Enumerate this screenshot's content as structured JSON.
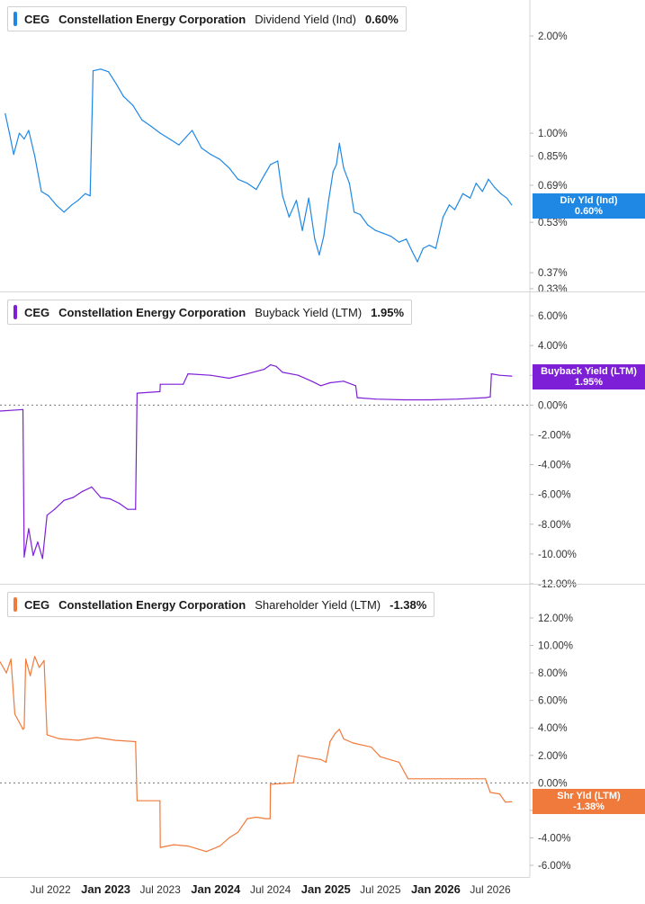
{
  "panels": [
    {
      "ticker": "CEG",
      "company": "Constellation Energy Corporation",
      "metric": "Dividend Yield (Ind)",
      "value": "0.60%",
      "badge_label": "Div Yld (Ind)",
      "badge_value": "0.60%",
      "color": "#1f88e5"
    },
    {
      "ticker": "CEG",
      "company": "Constellation Energy Corporation",
      "metric": "Buyback Yield (LTM)",
      "value": "1.95%",
      "badge_label": "Buyback Yield (LTM)",
      "badge_value": "1.95%",
      "color": "#7e1fd8"
    },
    {
      "ticker": "CEG",
      "company": "Constellation Energy Corporation",
      "metric": "Shareholder Yield (LTM)",
      "value": "-1.38%",
      "badge_label": "Shr Yld (LTM)",
      "badge_value": "-1.38%",
      "color": "#f07a3c"
    }
  ],
  "chart_data": [
    {
      "type": "line",
      "scale": "log",
      "y_ticks": [
        "2.00%",
        "1.00%",
        "0.85%",
        "0.69%",
        "0.53%",
        "0.37%",
        "0.33%"
      ],
      "y_tick_values": [
        2.0,
        1.0,
        0.85,
        0.69,
        0.53,
        0.37,
        0.33
      ],
      "ylim": [
        0.33,
        2.5
      ],
      "series": [
        {
          "name": "Dividend Yield (Ind)",
          "color": "#1f88e5",
          "points": [
            [
              "2022-02-01",
              1.15
            ],
            [
              "2022-02-15",
              1.0
            ],
            [
              "2022-03-01",
              0.86
            ],
            [
              "2022-03-20",
              1.0
            ],
            [
              "2022-04-05",
              0.96
            ],
            [
              "2022-04-20",
              1.02
            ],
            [
              "2022-05-10",
              0.85
            ],
            [
              "2022-06-01",
              0.66
            ],
            [
              "2022-06-25",
              0.64
            ],
            [
              "2022-07-20",
              0.6
            ],
            [
              "2022-08-15",
              0.57
            ],
            [
              "2022-09-10",
              0.6
            ],
            [
              "2022-10-01",
              0.62
            ],
            [
              "2022-10-25",
              0.65
            ],
            [
              "2022-11-10",
              0.64
            ],
            [
              "2022-11-20",
              1.56
            ],
            [
              "2022-12-15",
              1.58
            ],
            [
              "2023-01-10",
              1.55
            ],
            [
              "2023-02-05",
              1.42
            ],
            [
              "2023-03-01",
              1.3
            ],
            [
              "2023-04-01",
              1.22
            ],
            [
              "2023-05-01",
              1.1
            ],
            [
              "2023-06-01",
              1.05
            ],
            [
              "2023-07-01",
              1.0
            ],
            [
              "2023-08-01",
              0.96
            ],
            [
              "2023-09-01",
              0.92
            ],
            [
              "2023-10-15",
              1.02
            ],
            [
              "2023-11-15",
              0.9
            ],
            [
              "2023-12-15",
              0.86
            ],
            [
              "2024-01-15",
              0.83
            ],
            [
              "2024-02-15",
              0.78
            ],
            [
              "2024-03-15",
              0.72
            ],
            [
              "2024-04-15",
              0.7
            ],
            [
              "2024-05-15",
              0.67
            ],
            [
              "2024-06-10",
              0.74
            ],
            [
              "2024-07-01",
              0.8
            ],
            [
              "2024-07-25",
              0.82
            ],
            [
              "2024-08-10",
              0.64
            ],
            [
              "2024-09-01",
              0.55
            ],
            [
              "2024-09-25",
              0.62
            ],
            [
              "2024-10-15",
              0.5
            ],
            [
              "2024-11-05",
              0.63
            ],
            [
              "2024-11-25",
              0.47
            ],
            [
              "2024-12-10",
              0.42
            ],
            [
              "2024-12-25",
              0.48
            ],
            [
              "2025-01-10",
              0.62
            ],
            [
              "2025-01-25",
              0.76
            ],
            [
              "2025-02-05",
              0.8
            ],
            [
              "2025-02-15",
              0.93
            ],
            [
              "2025-03-01",
              0.78
            ],
            [
              "2025-03-20",
              0.7
            ],
            [
              "2025-04-05",
              0.57
            ],
            [
              "2025-04-25",
              0.56
            ],
            [
              "2025-05-20",
              0.52
            ],
            [
              "2025-06-15",
              0.5
            ],
            [
              "2025-07-10",
              0.49
            ],
            [
              "2025-08-05",
              0.48
            ],
            [
              "2025-09-01",
              0.46
            ],
            [
              "2025-09-25",
              0.47
            ],
            [
              "2025-10-15",
              0.43
            ],
            [
              "2025-11-01",
              0.4
            ],
            [
              "2025-11-20",
              0.44
            ],
            [
              "2025-12-10",
              0.45
            ],
            [
              "2026-01-01",
              0.44
            ],
            [
              "2026-01-25",
              0.55
            ],
            [
              "2026-02-15",
              0.6
            ],
            [
              "2026-03-05",
              0.58
            ],
            [
              "2026-04-01",
              0.65
            ],
            [
              "2026-04-25",
              0.63
            ],
            [
              "2026-05-15",
              0.7
            ],
            [
              "2026-06-05",
              0.66
            ],
            [
              "2026-06-25",
              0.72
            ],
            [
              "2026-07-15",
              0.68
            ],
            [
              "2026-08-05",
              0.65
            ],
            [
              "2026-08-25",
              0.63
            ],
            [
              "2026-09-10",
              0.6
            ]
          ]
        }
      ]
    },
    {
      "type": "line",
      "y_ticks": [
        "6.00%",
        "4.00%",
        "2.00%",
        "0.00%",
        "-2.00%",
        "-4.00%",
        "-6.00%",
        "-8.00%",
        "-10.00%",
        "-12.00%"
      ],
      "y_tick_values": [
        6,
        4,
        2,
        0,
        -2,
        -4,
        -6,
        -8,
        -10,
        -12
      ],
      "ylim": [
        -12,
        7
      ],
      "series": [
        {
          "name": "Buyback Yield (LTM)",
          "color": "#7e1fd8",
          "points": [
            [
              "2022-01-15",
              -0.4
            ],
            [
              "2022-04-01",
              -0.3
            ],
            [
              "2022-04-05",
              -10.2
            ],
            [
              "2022-04-20",
              -8.3
            ],
            [
              "2022-05-05",
              -10.1
            ],
            [
              "2022-05-20",
              -9.2
            ],
            [
              "2022-06-05",
              -10.3
            ],
            [
              "2022-06-20",
              -7.4
            ],
            [
              "2022-07-15",
              -7.0
            ],
            [
              "2022-08-15",
              -6.4
            ],
            [
              "2022-09-15",
              -6.2
            ],
            [
              "2022-10-15",
              -5.8
            ],
            [
              "2022-11-15",
              -5.5
            ],
            [
              "2022-12-15",
              -6.2
            ],
            [
              "2023-01-15",
              -6.3
            ],
            [
              "2023-02-15",
              -6.6
            ],
            [
              "2023-03-15",
              -7.0
            ],
            [
              "2023-04-10",
              -7.0
            ],
            [
              "2023-04-15",
              0.8
            ],
            [
              "2023-06-30",
              0.9
            ],
            [
              "2023-07-01",
              1.4
            ],
            [
              "2023-09-15",
              1.4
            ],
            [
              "2023-10-01",
              2.1
            ],
            [
              "2023-12-15",
              2.0
            ],
            [
              "2024-02-15",
              1.8
            ],
            [
              "2024-04-15",
              2.1
            ],
            [
              "2024-06-10",
              2.4
            ],
            [
              "2024-07-01",
              2.7
            ],
            [
              "2024-07-20",
              2.6
            ],
            [
              "2024-08-10",
              2.2
            ],
            [
              "2024-10-01",
              2.0
            ],
            [
              "2024-11-15",
              1.6
            ],
            [
              "2024-12-15",
              1.3
            ],
            [
              "2025-01-15",
              1.5
            ],
            [
              "2025-03-01",
              1.6
            ],
            [
              "2025-04-10",
              1.3
            ],
            [
              "2025-04-15",
              0.5
            ],
            [
              "2025-06-15",
              0.4
            ],
            [
              "2025-09-15",
              0.35
            ],
            [
              "2025-12-15",
              0.35
            ],
            [
              "2026-03-15",
              0.4
            ],
            [
              "2026-06-15",
              0.5
            ],
            [
              "2026-07-01",
              0.55
            ],
            [
              "2026-07-05",
              2.1
            ],
            [
              "2026-08-01",
              2.0
            ],
            [
              "2026-09-10",
              1.95
            ]
          ]
        }
      ]
    },
    {
      "type": "line",
      "y_ticks": [
        "12.00%",
        "10.00%",
        "8.00%",
        "6.00%",
        "4.00%",
        "2.00%",
        "0.00%",
        "-2.00%",
        "-4.00%",
        "-6.00%"
      ],
      "y_tick_values": [
        12,
        10,
        8,
        6,
        4,
        2,
        0,
        -2,
        -4,
        -6
      ],
      "ylim": [
        -6.5,
        13
      ],
      "x_ticks": [
        "Jul 2022",
        "Jan 2023",
        "Jul 2023",
        "Jan 2024",
        "Jul 2024",
        "Jan 2025",
        "Jul 2025",
        "Jan 2026",
        "Jul 2026"
      ],
      "x_tick_dates": [
        "2022-07-01",
        "2023-01-01",
        "2023-07-01",
        "2024-01-01",
        "2024-07-01",
        "2025-01-01",
        "2025-07-01",
        "2026-01-01",
        "2026-07-01"
      ],
      "x_tick_bold": [
        false,
        true,
        false,
        true,
        false,
        true,
        false,
        true,
        false
      ],
      "series": [
        {
          "name": "Shareholder Yield (LTM)",
          "color": "#f07a3c",
          "points": [
            [
              "2022-01-15",
              8.8
            ],
            [
              "2022-02-05",
              8.0
            ],
            [
              "2022-02-20",
              9.0
            ],
            [
              "2022-03-05",
              5.0
            ],
            [
              "2022-03-20",
              4.4
            ],
            [
              "2022-04-01",
              3.9
            ],
            [
              "2022-04-05",
              4.0
            ],
            [
              "2022-04-10",
              9.0
            ],
            [
              "2022-04-25",
              7.8
            ],
            [
              "2022-05-10",
              9.2
            ],
            [
              "2022-05-25",
              8.4
            ],
            [
              "2022-06-10",
              8.9
            ],
            [
              "2022-06-20",
              3.5
            ],
            [
              "2022-08-01",
              3.2
            ],
            [
              "2022-10-01",
              3.1
            ],
            [
              "2022-12-01",
              3.3
            ],
            [
              "2023-02-01",
              3.1
            ],
            [
              "2023-04-10",
              3.0
            ],
            [
              "2023-04-15",
              -1.3
            ],
            [
              "2023-06-30",
              -1.3
            ],
            [
              "2023-07-01",
              -4.7
            ],
            [
              "2023-08-15",
              -4.5
            ],
            [
              "2023-10-01",
              -4.6
            ],
            [
              "2023-12-01",
              -5.0
            ],
            [
              "2024-01-15",
              -4.6
            ],
            [
              "2024-02-15",
              -4.0
            ],
            [
              "2024-03-15",
              -3.6
            ],
            [
              "2024-04-15",
              -2.6
            ],
            [
              "2024-05-15",
              -2.5
            ],
            [
              "2024-06-15",
              -2.6
            ],
            [
              "2024-06-30",
              -2.6
            ],
            [
              "2024-07-01",
              -0.1
            ],
            [
              "2024-09-15",
              0.0
            ],
            [
              "2024-10-01",
              2.0
            ],
            [
              "2024-11-15",
              1.8
            ],
            [
              "2024-12-15",
              1.7
            ],
            [
              "2025-01-01",
              1.5
            ],
            [
              "2025-01-15",
              3.0
            ],
            [
              "2025-02-01",
              3.6
            ],
            [
              "2025-02-15",
              3.9
            ],
            [
              "2025-03-01",
              3.2
            ],
            [
              "2025-04-01",
              2.9
            ],
            [
              "2025-06-01",
              2.6
            ],
            [
              "2025-07-01",
              1.9
            ],
            [
              "2025-09-01",
              1.5
            ],
            [
              "2025-10-01",
              0.3
            ],
            [
              "2025-12-01",
              0.3
            ],
            [
              "2026-03-15",
              0.3
            ],
            [
              "2026-06-15",
              0.3
            ],
            [
              "2026-07-01",
              -0.7
            ],
            [
              "2026-08-01",
              -0.8
            ],
            [
              "2026-08-20",
              -1.4
            ],
            [
              "2026-09-10",
              -1.38
            ]
          ]
        }
      ]
    }
  ]
}
